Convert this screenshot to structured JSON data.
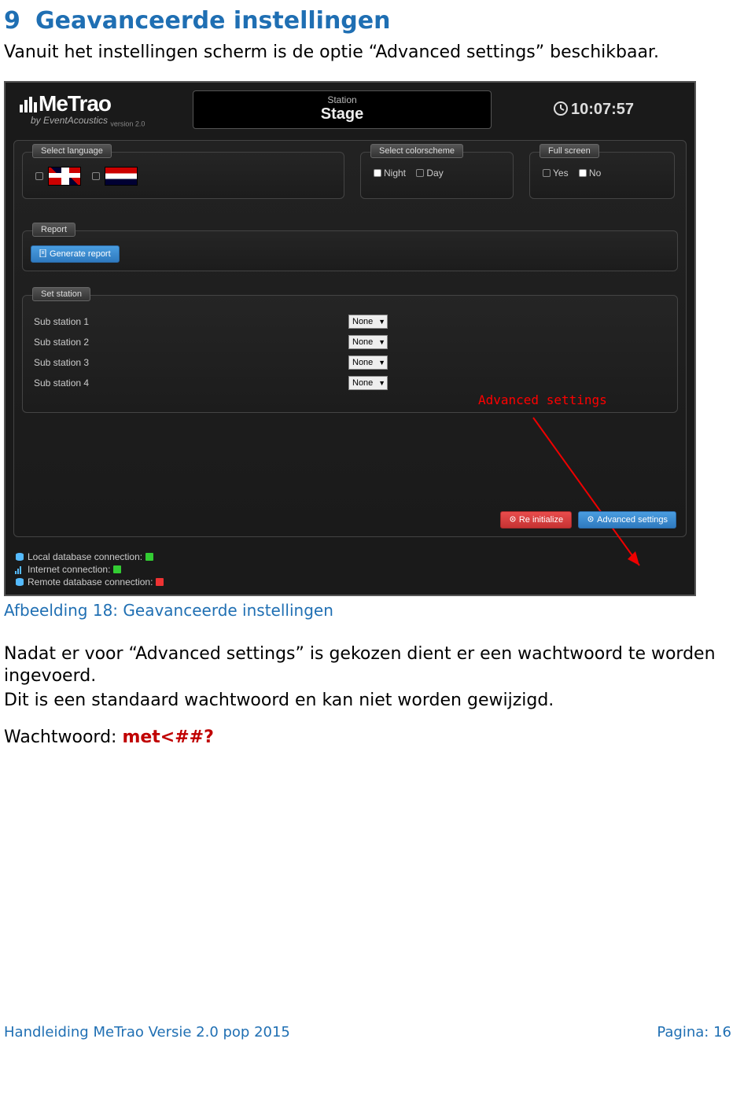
{
  "section": {
    "num": "9",
    "title": "Geavanceerde instellingen"
  },
  "intro": "Vanuit het instellingen scherm is de optie “Advanced settings” beschikbaar.",
  "screenshot": {
    "logo_main": "MeTrao",
    "logo_sub_prefix": "by ",
    "logo_sub": "EventAcoustics",
    "logo_version": "version 2.0",
    "station_label": "Station",
    "station_value": "Stage",
    "clock": "10:07:57",
    "lang_legend": "Select language",
    "color_legend": "Select colorscheme",
    "color_opt1": "Night",
    "color_opt2": "Day",
    "full_legend": "Full screen",
    "full_opt1": "Yes",
    "full_opt2": "No",
    "report_legend": "Report",
    "generate_report": "Generate report",
    "setstation_legend": "Set station",
    "substations": [
      {
        "label": "Sub station 1",
        "value": "None"
      },
      {
        "label": "Sub station 2",
        "value": "None"
      },
      {
        "label": "Sub station 3",
        "value": "None"
      },
      {
        "label": "Sub station 4",
        "value": "None"
      }
    ],
    "reinitialize": "Re initialize",
    "advanced_settings": "Advanced settings",
    "annotation": "Advanced settings",
    "status": {
      "local": "Local database connection:",
      "internet": "Internet connection:",
      "remote": "Remote database connection:"
    }
  },
  "caption": "Afbeelding 18: Geavanceerde instellingen",
  "para1": "Nadat er voor “Advanced settings” is gekozen dient er een wachtwoord te worden ingevoerd.",
  "para2": "Dit is een standaard wachtwoord en kan niet worden gewijzigd.",
  "pw_label": "Wachtwoord: ",
  "pw_value": "met<##?",
  "footer_left": "Handleiding MeTrao Versie 2.0 pop 2015",
  "footer_right": "Pagina: 16"
}
